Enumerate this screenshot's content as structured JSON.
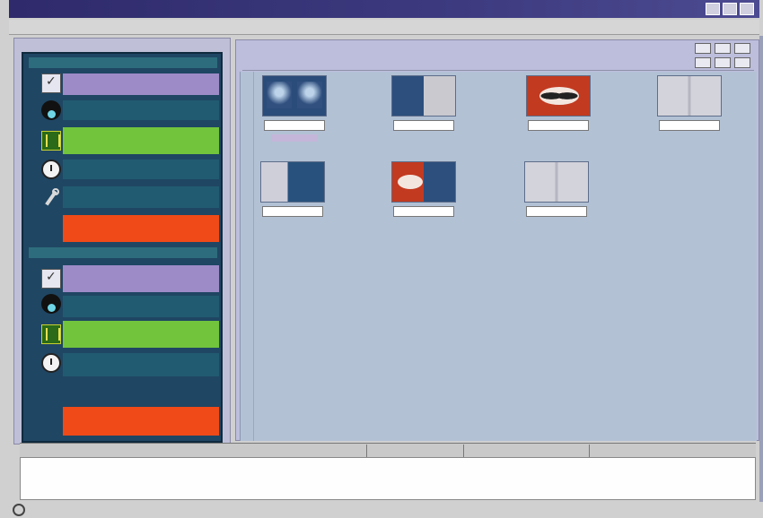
{
  "window": {
    "title": "",
    "titlebar_buttons": [
      "",
      "",
      ""
    ]
  },
  "menu": {
    "items": [
      "",
      "",
      "",
      ""
    ]
  },
  "sidebar": {
    "sections": [
      {
        "header": "",
        "header_right": "",
        "items": [
          {
            "icon": "checklist-icon",
            "label": "",
            "color": "#9d8bc7"
          },
          {
            "icon": "person-icon",
            "label": "",
            "color": "#215b72"
          },
          {
            "icon": "grid-icon",
            "label": "",
            "color": "#72c43d"
          },
          {
            "icon": "clock-icon",
            "label": "",
            "color": "#215b72"
          },
          {
            "icon": "wrench-icon",
            "label": "",
            "color": "#215b72"
          },
          {
            "icon": "",
            "label": "",
            "color": "#f04a18"
          }
        ]
      },
      {
        "header": "",
        "header_right": "",
        "items": [
          {
            "icon": "checklist-icon",
            "label": "",
            "color": "#9d8bc7"
          },
          {
            "icon": "person-icon",
            "label": "",
            "color": "#215b72"
          },
          {
            "icon": "grid-icon",
            "label": "",
            "color": "#72c43d"
          },
          {
            "icon": "clock-icon",
            "label": "",
            "color": "#215b72"
          },
          {
            "icon": "",
            "label": "",
            "color": "#f04a18"
          }
        ]
      }
    ]
  },
  "thumbnails": [
    {
      "caption": "",
      "style": "blue"
    },
    {
      "caption": "",
      "style": "bluegrey"
    },
    {
      "caption": "",
      "style": "red"
    },
    {
      "caption": "",
      "style": "grey"
    },
    {
      "caption": "",
      "style": "greyblue"
    },
    {
      "caption": "",
      "style": "redblue"
    },
    {
      "caption": "",
      "style": "grey"
    }
  ],
  "statusbar": {
    "cells": [
      "",
      "",
      "",
      ""
    ]
  },
  "bottom": {
    "text": ""
  },
  "colors": {
    "titlebar": "#2e2a6b",
    "sidebar_bg": "#1f4663",
    "content_bg": "#b3c1d5",
    "accent_orange": "#f04a18",
    "accent_green": "#72c43d",
    "accent_lavender": "#9d8bc7"
  }
}
